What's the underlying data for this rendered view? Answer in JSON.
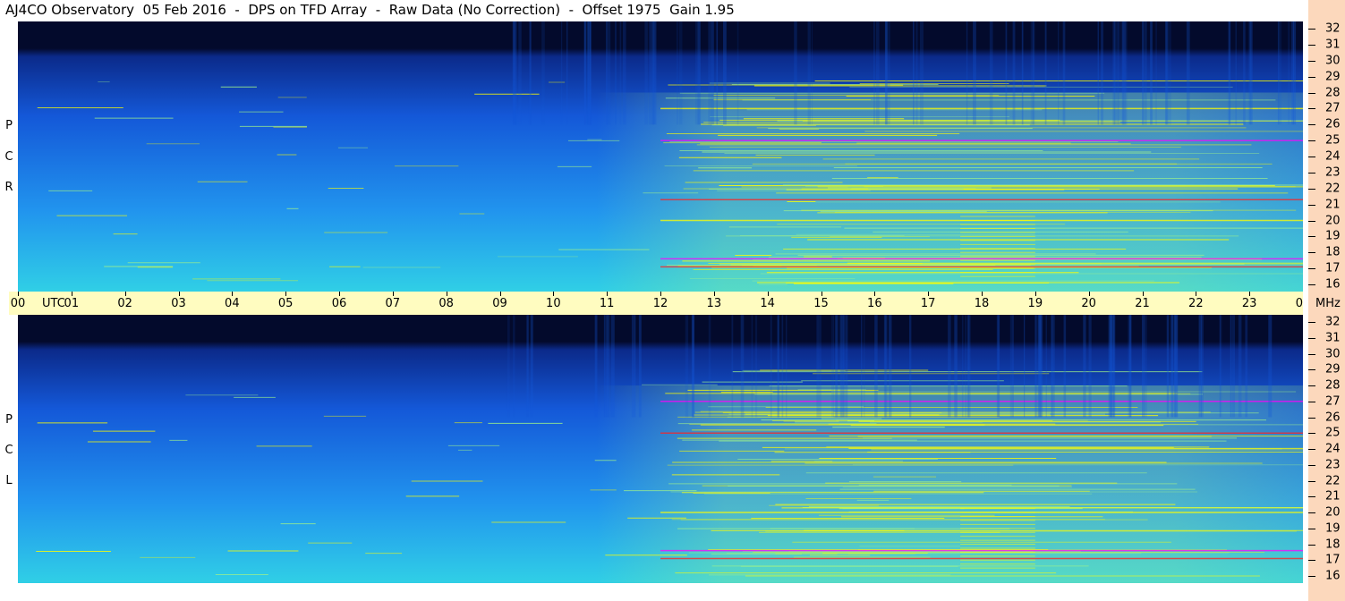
{
  "title": "AJ4CO Observatory  05 Feb 2016  -  DPS on TFD Array  -  Raw Data (No Correction)  -  Offset 1975  Gain 1.95",
  "colors": {
    "utc_bar": "#fffcc0",
    "freq_strip": "#fcd8bc",
    "colormap": [
      "#030a2c",
      "#0b2a8a",
      "#1458d8",
      "#2194ee",
      "#30cfe6",
      "#9cf08c",
      "#ffff00",
      "#ff2020",
      "#ff00ff"
    ]
  },
  "chart_data": [
    {
      "type": "heatmap",
      "panel": "RCP",
      "polarization_letters": [
        "R",
        "C",
        "P"
      ],
      "x_axis": {
        "label": "UTC",
        "ticks": [
          "00",
          "01",
          "02",
          "03",
          "04",
          "05",
          "06",
          "07",
          "08",
          "09",
          "10",
          "11",
          "12",
          "13",
          "14",
          "15",
          "16",
          "17",
          "18",
          "19",
          "20",
          "21",
          "22",
          "23",
          "00"
        ],
        "range_hours": [
          0,
          24
        ]
      },
      "y_axis": {
        "unit": "MHz",
        "ticks": [
          16,
          17,
          18,
          19,
          20,
          21,
          22,
          23,
          24,
          25,
          26,
          27,
          28,
          29,
          30,
          31,
          32
        ],
        "range": [
          16,
          32
        ]
      },
      "features": {
        "quiet_bands_before_hour": 12,
        "active_after_hour": 12,
        "strong_lines_mhz": [
          17.1,
          17.6,
          20.0,
          21.3,
          25.0,
          27.0
        ],
        "burst_window_hours": [
          17.6,
          19.0
        ]
      }
    },
    {
      "type": "heatmap",
      "panel": "LCP",
      "polarization_letters": [
        "L",
        "C",
        "P"
      ],
      "x_axis": {
        "label": "UTC",
        "ticks": [
          "00",
          "01",
          "02",
          "03",
          "04",
          "05",
          "06",
          "07",
          "08",
          "09",
          "10",
          "11",
          "12",
          "13",
          "14",
          "15",
          "16",
          "17",
          "18",
          "19",
          "20",
          "21",
          "22",
          "23",
          "00"
        ],
        "range_hours": [
          0,
          24
        ]
      },
      "y_axis": {
        "unit": "MHz",
        "ticks": [
          16,
          17,
          18,
          19,
          20,
          21,
          22,
          23,
          24,
          25,
          26,
          27,
          28,
          29,
          30,
          31,
          32
        ],
        "range": [
          16,
          32
        ]
      },
      "features": {
        "quiet_bands_before_hour": 12,
        "active_after_hour": 12,
        "strong_lines_mhz": [
          17.1,
          17.6,
          20.0,
          25.0,
          27.0
        ],
        "burst_window_hours": [
          17.6,
          19.0
        ]
      }
    }
  ],
  "utc_unit": "UTC",
  "mhz_unit": "MHz"
}
